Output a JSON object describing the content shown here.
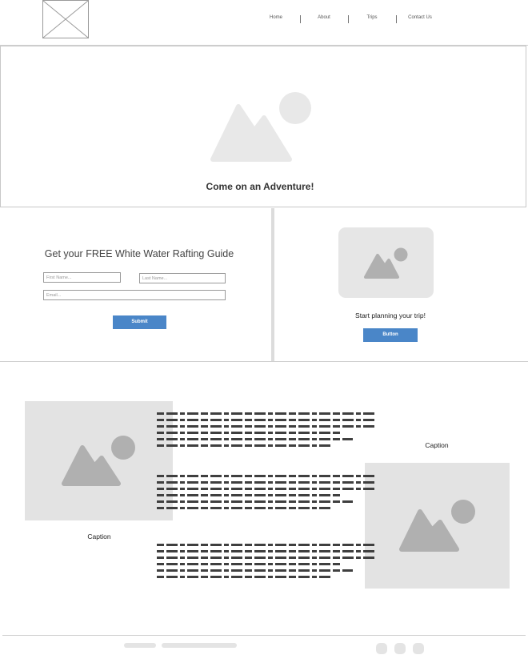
{
  "nav": {
    "items": [
      "Home",
      "About",
      "Trips",
      "Contact Us"
    ]
  },
  "hero": {
    "title": "Come on an Adventure!"
  },
  "signup": {
    "title": "Get your FREE White Water Rafting Guide",
    "first_name_placeholder": "First Name...",
    "last_name_placeholder": "Last Name...",
    "email_placeholder": "Email...",
    "submit_label": "Submit"
  },
  "promo": {
    "text": "Start planning your trip!",
    "button_label": "Button"
  },
  "content": {
    "caption_left": "Caption",
    "caption_right": "Caption"
  },
  "colors": {
    "accent": "#4a86c8",
    "placeholder_fill": "#e3e3e3",
    "placeholder_icon": "#b0b0b0"
  }
}
